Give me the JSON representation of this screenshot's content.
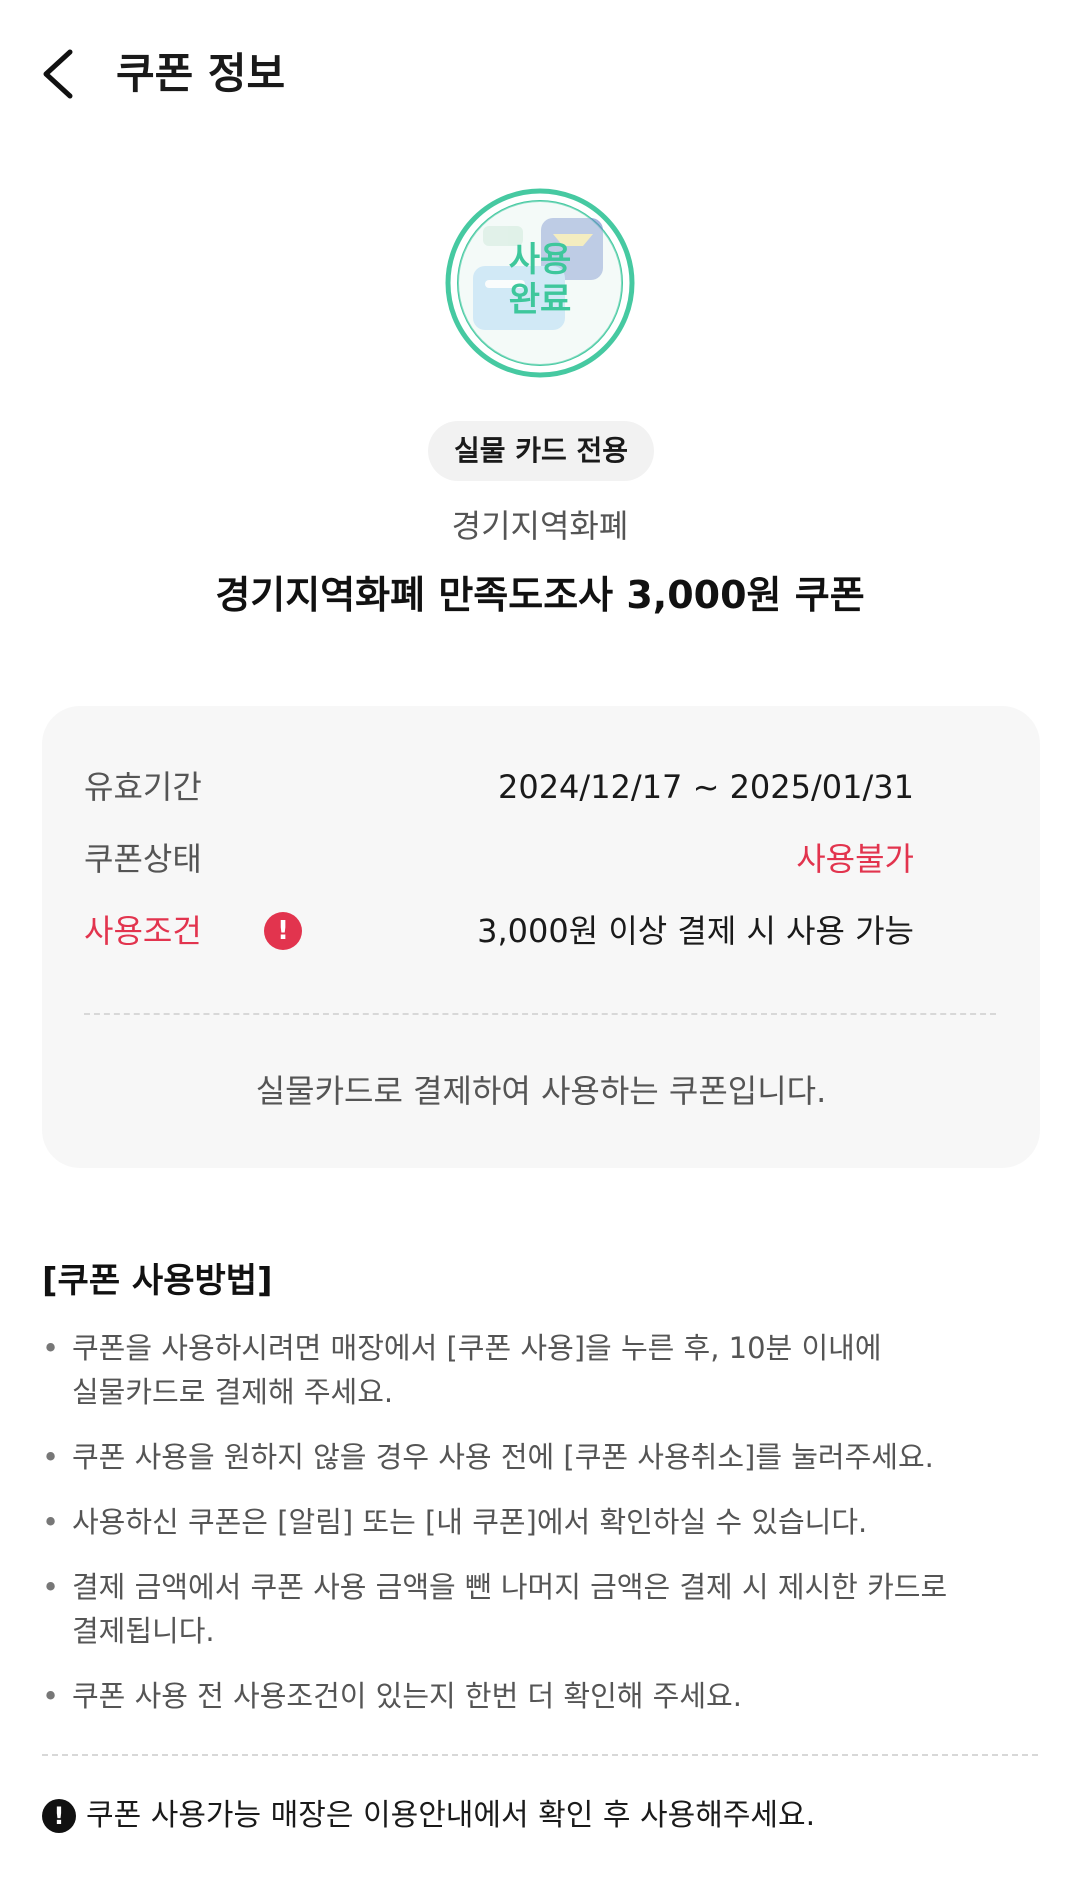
{
  "header": {
    "title": "쿠폰 정보",
    "back_icon": "chevron-left-icon"
  },
  "coupon": {
    "stamp_text": "사용완료",
    "stamp_line1": "사용",
    "stamp_line2": "완료",
    "chip_label": "실물 카드 전용",
    "brand": "경기지역화폐",
    "title": "경기지역화폐 만족도조사 3,000원 쿠폰",
    "accent_color": "#3ec79c"
  },
  "details": {
    "validity_label": "유효기간",
    "validity_value": "2024/12/17 ~ 2025/01/31",
    "status_label": "쿠폰상태",
    "status_value": "사용불가",
    "condition_label": "사용조건",
    "condition_value": "3,000원 이상 결제 시 사용 가능",
    "alert_icon": "exclamation-circle-icon",
    "note": "실물카드로 결제하여 사용하는 쿠폰입니다.",
    "warning_color": "#e2344e"
  },
  "how_to_use": {
    "title": "[쿠폰 사용방법]",
    "items": [
      "쿠폰을 사용하시려면 매장에서 [쿠폰 사용]을 누른 후, 10분 이내에",
      "실물카드로 결제해 주세요.",
      "쿠폰 사용을 원하지 않을 경우 사용 전에 [쿠폰 사용취소]를 눌러주세요.",
      "사용하신 쿠폰은 [알림] 또는 [내 쿠폰]에서 확인하실 수 있습니다.",
      "결제 금액에서 쿠폰 사용 금액을 뺀 나머지 금액은 결제 시 제시한 카드로",
      "결제됩니다.",
      "쿠폰 사용 전 사용조건이 있는지 한번 더 확인해 주세요."
    ]
  },
  "notice": {
    "icon": "exclamation-circle-icon",
    "text": "쿠폰 사용가능 매장은 이용안내에서 확인 후 사용해주세요."
  }
}
